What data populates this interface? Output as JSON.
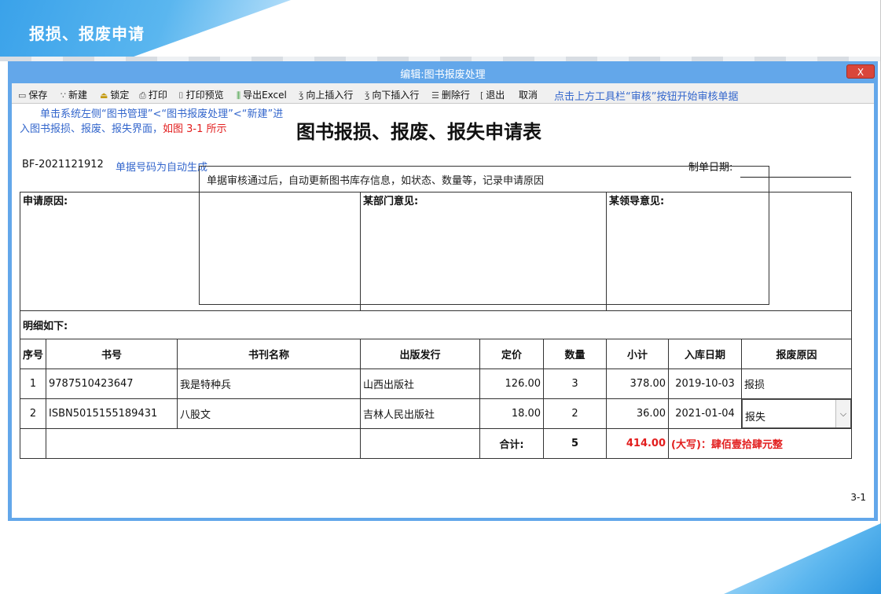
{
  "slide": {
    "title": "报损、报废申请"
  },
  "window": {
    "title": "编辑:图书报废处理",
    "close_label": "X"
  },
  "toolbar": {
    "save": "保存",
    "new": "新建",
    "lock": "锁定",
    "print": "打印",
    "print_preview": "打印预览",
    "export_excel": "导出Excel",
    "insert_above": "向上插入行",
    "insert_below": "向下插入行",
    "delete_row": "删除行",
    "exit": "退出",
    "cancel": "取消",
    "hint": "点击上方工具栏“审核”按钮开始审核单据"
  },
  "annotation": {
    "instruction": "单击系统左侧“图书管理”<“图书报废处理”<“新建”进入图书报损、报废、报失界面，",
    "instruction_ref": "如图 3-1 所示",
    "callout": "单据审核通过后，自动更新图书库存信息，如状态、数量等，记录申请原因"
  },
  "form": {
    "title": "图书报损、报废、报失申请表",
    "bill_no": "BF-2021121912",
    "bill_no_note": "单据号码为自动生成",
    "date_label": "制单日期:",
    "opinion_labels": [
      "申请原因:",
      "某部门意见:",
      "某领导意见:"
    ],
    "detail_label": "明细如下:",
    "columns": [
      "序号",
      "书号",
      "书刊名称",
      "出版发行",
      "定价",
      "数量",
      "小计",
      "入库日期",
      "报废原因"
    ],
    "rows": [
      [
        "1",
        "9787510423647",
        "我是特种兵",
        "山西出版社",
        "126.00",
        "3",
        "378.00",
        "2019-10-03",
        "报损"
      ],
      [
        "2",
        "ISBN5015155189431",
        "八股文",
        "吉林人民出版社",
        "18.00",
        "2",
        "36.00",
        "2021-01-04",
        "报失"
      ]
    ],
    "total": {
      "label": "合计:",
      "quantity": "5",
      "amount": "414.00",
      "amount_words": "(大写)：肆佰壹拾肆元整"
    }
  },
  "page_number": "3-1"
}
